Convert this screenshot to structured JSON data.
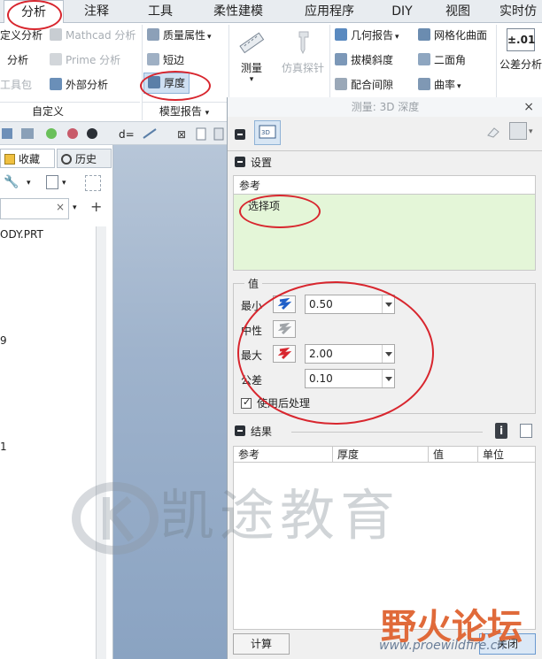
{
  "tabs": [
    {
      "label": "分析",
      "active": true
    },
    {
      "label": "注释"
    },
    {
      "label": "工具"
    },
    {
      "label": "柔性建模"
    },
    {
      "label": "应用程序"
    },
    {
      "label": "DIY"
    },
    {
      "label": "视图"
    },
    {
      "label": "实时仿"
    }
  ],
  "ribbon": {
    "col1": [
      "定义分析",
      "分析",
      "工具包"
    ],
    "col2": [
      "Mathcad 分析",
      "Prime 分析",
      "外部分析"
    ],
    "col3": [
      "质量属性",
      "短边",
      "厚度"
    ],
    "big": [
      "测量",
      "仿真探针"
    ],
    "col4": [
      "几何报告",
      "拔模斜度",
      "配合间隙"
    ],
    "col5": [
      "网格化曲面",
      "二面角",
      "曲率"
    ],
    "tol_icon_text": "±.01",
    "tol_label": "公差分析",
    "group_custom": "自定义",
    "group_model_report": "模型报告"
  },
  "navigator": {
    "tab_favorites": "收藏",
    "tab_history": "历史",
    "file_name": "ODY.PRT",
    "row_a": "9",
    "row_b": "1"
  },
  "dialog": {
    "title": "测量: 3D 深度",
    "settings_header": "设置",
    "ref_label": "参考",
    "ref_placeholder": "选择项",
    "values_header": "值",
    "min_label": "最小",
    "min_value": "0.50",
    "neutral_label": "中性",
    "max_label": "最大",
    "max_value": "2.00",
    "tol_label": "公差",
    "tol_value": "0.10",
    "postprocess_label": "使用后处理",
    "postprocess_checked": true,
    "results_header": "结果",
    "results_columns": [
      "参考",
      "厚度",
      "值",
      "单位"
    ],
    "compute_button": "计算",
    "close_button": "关闭"
  },
  "watermarks": {
    "kaitu": "凯途教育",
    "forum": "野火论坛",
    "url": "www.proewildfire.cn"
  },
  "colors": {
    "accent_red": "#d8262e",
    "ref_box_bg": "#e4f6d8",
    "graphics_blue": "#9fb3cc"
  }
}
